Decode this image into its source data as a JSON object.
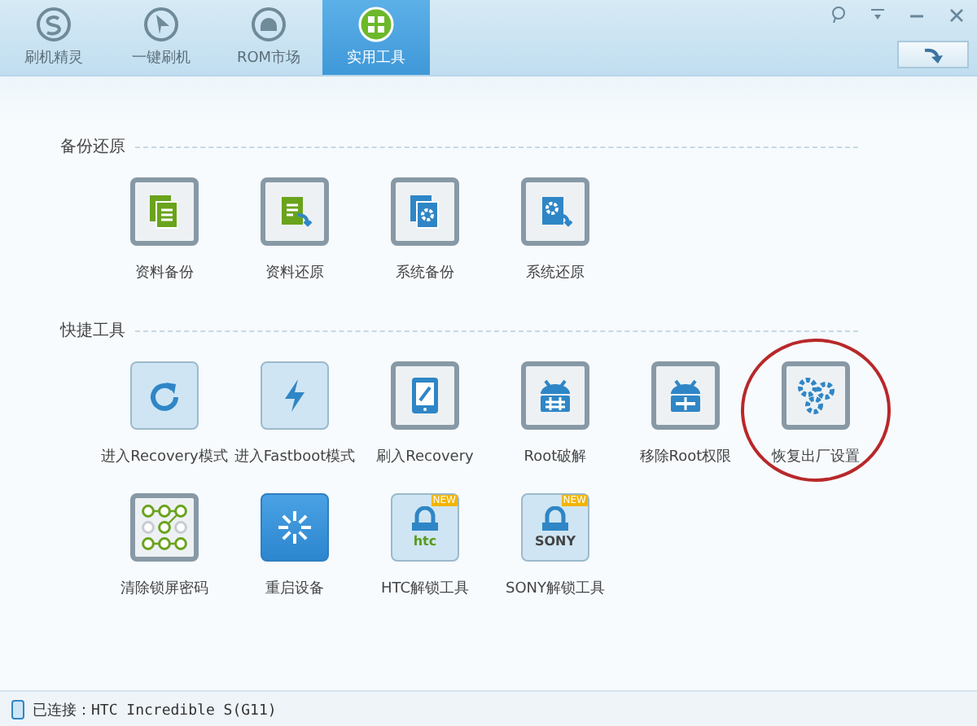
{
  "tabs": [
    {
      "label": "刷机精灵",
      "selected": false
    },
    {
      "label": "一键刷机",
      "selected": false
    },
    {
      "label": "ROM市场",
      "selected": false
    },
    {
      "label": "实用工具",
      "selected": true
    }
  ],
  "sections": [
    {
      "title": "备份还原",
      "tools": [
        {
          "label": "资料备份",
          "kind": "data-backup",
          "highlighted": false
        },
        {
          "label": "资料还原",
          "kind": "data-restore",
          "highlighted": false
        },
        {
          "label": "系统备份",
          "kind": "system-backup",
          "highlighted": false
        },
        {
          "label": "系统还原",
          "kind": "system-restore",
          "highlighted": false
        }
      ]
    },
    {
      "title": "快捷工具",
      "tools": [
        {
          "label": "进入Recovery模式",
          "kind": "recovery",
          "highlighted": false
        },
        {
          "label": "进入Fastboot模式",
          "kind": "fastboot",
          "highlighted": false
        },
        {
          "label": "刷入Recovery",
          "kind": "flash",
          "highlighted": false
        },
        {
          "label": "Root破解",
          "kind": "root",
          "highlighted": false
        },
        {
          "label": "移除Root权限",
          "kind": "unroot",
          "highlighted": false
        },
        {
          "label": "恢复出厂设置",
          "kind": "factory",
          "highlighted": true
        },
        {
          "label": "清除锁屏密码",
          "kind": "pattern",
          "highlighted": false
        },
        {
          "label": "重启设备",
          "kind": "reboot",
          "highlighted": false
        },
        {
          "label": "HTC解锁工具",
          "kind": "htc",
          "badge": "NEW",
          "brand": "htc",
          "highlighted": false
        },
        {
          "label": "SONY解锁工具",
          "kind": "sony",
          "badge": "NEW",
          "brand": "SONY",
          "highlighted": false
        }
      ]
    }
  ],
  "status_bar": {
    "text": "已连接：HTC Incredible S(G11)"
  }
}
